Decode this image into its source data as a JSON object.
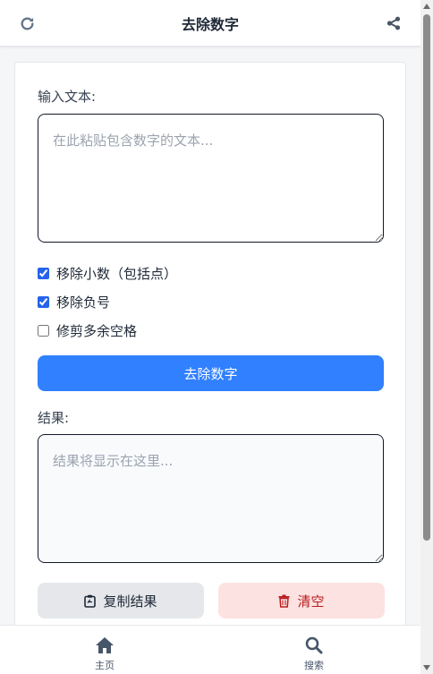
{
  "header": {
    "title": "去除数字",
    "refresh_icon": "refresh-icon",
    "share_icon": "share-icon"
  },
  "form": {
    "input_label": "输入文本:",
    "input_placeholder": "在此粘贴包含数字的文本...",
    "input_value": "",
    "options": [
      {
        "label": "移除小数（包括点）",
        "checked": true
      },
      {
        "label": "移除负号",
        "checked": true
      },
      {
        "label": "修剪多余空格",
        "checked": false
      }
    ],
    "submit_label": "去除数字",
    "result_label": "结果:",
    "result_placeholder": "结果将显示在这里...",
    "result_value": "",
    "copy_label": "复制结果",
    "clear_label": "清空"
  },
  "nav": {
    "home_label": "主页",
    "search_label": "搜索"
  },
  "colors": {
    "primary": "#3080ff",
    "danger_bg": "#fde2e2",
    "danger_text": "#b91c1c"
  }
}
